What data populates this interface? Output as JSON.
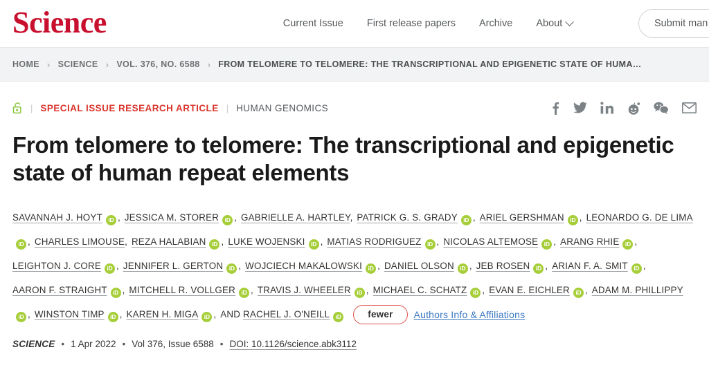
{
  "site": {
    "logo_text": "Science",
    "nav_links": [
      {
        "label": "Current Issue",
        "has_chevron": false
      },
      {
        "label": "First release papers",
        "has_chevron": false
      },
      {
        "label": "Archive",
        "has_chevron": false
      },
      {
        "label": "About",
        "has_chevron": true
      }
    ],
    "submit_button": "Submit man"
  },
  "breadcrumb": {
    "items": [
      "HOME",
      "SCIENCE",
      "VOL. 376, NO. 6588",
      "FROM TELOMERE TO TELOMERE: THE TRANSCRIPTIONAL AND EPIGENETIC STATE OF HUMA…"
    ],
    "separator": "›"
  },
  "article": {
    "access_icon": "open-lock-icon",
    "category_primary": "SPECIAL ISSUE RESEARCH ARTICLE",
    "category_secondary": "HUMAN GENOMICS",
    "divider": "|",
    "title": "From telomere to telomere: The transcriptional and epigenetic state of human repeat elements",
    "share_icons": [
      "facebook-icon",
      "twitter-icon",
      "linkedin-icon",
      "reddit-icon",
      "wechat-icon",
      "email-icon"
    ],
    "authors": [
      {
        "name": "SAVANNAH J. HOYT",
        "orcid": true
      },
      {
        "name": "JESSICA M. STORER",
        "orcid": true
      },
      {
        "name": "GABRIELLE A. HARTLEY",
        "orcid": false
      },
      {
        "name": "PATRICK G. S. GRADY",
        "orcid": true
      },
      {
        "name": "ARIEL GERSHMAN",
        "orcid": true
      },
      {
        "name": "LEONARDO G. DE LIMA",
        "orcid": true
      },
      {
        "name": "CHARLES LIMOUSE",
        "orcid": false
      },
      {
        "name": "REZA HALABIAN",
        "orcid": true
      },
      {
        "name": "LUKE WOJENSKI",
        "orcid": true
      },
      {
        "name": "MATIAS RODRIGUEZ",
        "orcid": true
      },
      {
        "name": "NICOLAS ALTEMOSE",
        "orcid": true
      },
      {
        "name": "ARANG RHIE",
        "orcid": true
      },
      {
        "name": "LEIGHTON J. CORE",
        "orcid": true
      },
      {
        "name": "JENNIFER L. GERTON",
        "orcid": true
      },
      {
        "name": "WOJCIECH MAKALOWSKI",
        "orcid": true
      },
      {
        "name": "DANIEL OLSON",
        "orcid": true
      },
      {
        "name": "JEB ROSEN",
        "orcid": true
      },
      {
        "name": "ARIAN F. A. SMIT",
        "orcid": true
      },
      {
        "name": "AARON F. STRAIGHT",
        "orcid": true
      },
      {
        "name": "MITCHELL R. VOLLGER",
        "orcid": true
      },
      {
        "name": "TRAVIS J. WHEELER",
        "orcid": true
      },
      {
        "name": "MICHAEL C. SCHATZ",
        "orcid": true
      },
      {
        "name": "EVAN E. EICHLER",
        "orcid": true
      },
      {
        "name": "ADAM M. PHILLIPPY",
        "orcid": true
      },
      {
        "name": "WINSTON TIMP",
        "orcid": true
      },
      {
        "name": "KAREN H. MIGA",
        "orcid": true
      },
      {
        "name": "RACHEL J. O'NEILL",
        "orcid": true,
        "preceded_by_and": true
      }
    ],
    "orcid_label": "iD",
    "and_label": "AND",
    "fewer_button": "fewer",
    "affiliations_link": "Authors Info & Affiliations",
    "publication": {
      "journal": "SCIENCE",
      "date": "1 Apr 2022",
      "volume_issue": "Vol 376, Issue 6588",
      "doi": "DOI: 10.1126/science.abk3112",
      "dot": "•"
    }
  },
  "colors": {
    "brand_red": "#c8102e",
    "category_red": "#d9352c",
    "orcid_green": "#a6ce39",
    "link_blue": "#3b78c3",
    "fewer_border": "#e0544b"
  }
}
